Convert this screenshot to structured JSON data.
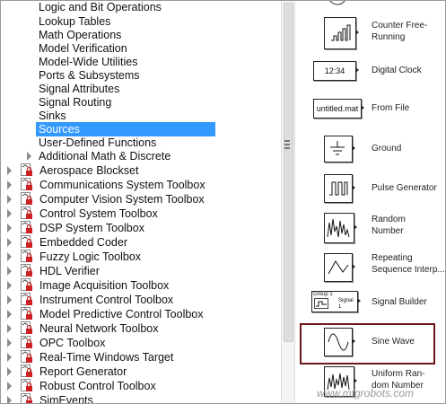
{
  "tree": {
    "sub_items": [
      "Logic and Bit Operations",
      "Lookup Tables",
      "Math Operations",
      "Model Verification",
      "Model-Wide Utilities",
      "Ports & Subsystems",
      "Signal Attributes",
      "Signal Routing",
      "Sinks",
      "Sources",
      "User-Defined Functions",
      "Additional Math & Discrete"
    ],
    "selected": "Sources",
    "libraries": [
      "Aerospace Blockset",
      "Communications System Toolbox",
      "Computer Vision System Toolbox",
      "Control System Toolbox",
      "DSP System Toolbox",
      "Embedded Coder",
      "Fuzzy Logic Toolbox",
      "HDL Verifier",
      "Image Acquisition Toolbox",
      "Instrument Control Toolbox",
      "Model Predictive Control Toolbox",
      "Neural Network Toolbox",
      "OPC Toolbox",
      "Real-Time Windows Target",
      "Report Generator",
      "Robust Control Toolbox",
      "SimEvents"
    ]
  },
  "blocks": {
    "counter_free_running": {
      "line1": "Counter Free-",
      "line2": "Running"
    },
    "digital_clock": {
      "label": "Digital Clock",
      "icon_text": "12:34"
    },
    "from_file": {
      "label": "From File",
      "icon_text": "untitled.mat"
    },
    "ground": {
      "label": "Ground"
    },
    "pulse_generator": {
      "label": "Pulse Generator"
    },
    "random_number": {
      "line1": "Random",
      "line2": "Number"
    },
    "repeating_sequence": {
      "line1": "Repeating",
      "line2": "Sequence Interp..."
    },
    "signal_builder": {
      "label": "Signal Builder",
      "icon_group": "Group 1",
      "icon_signal": "Signal 1"
    },
    "sine_wave": {
      "label": "Sine Wave"
    },
    "uniform_random": {
      "line1": "Uniform Ran-",
      "line2": "dom Number"
    }
  },
  "watermark": "www.mfgrobots.com",
  "colors": {
    "selection": "#3399ff",
    "highlight_box": "#6b1717",
    "lib_icon_red": "#cc2222"
  }
}
